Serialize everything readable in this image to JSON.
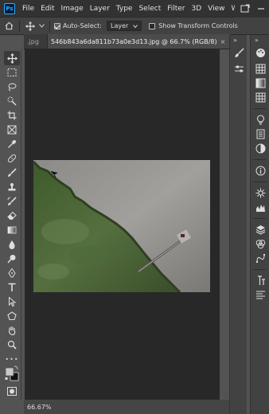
{
  "app": {
    "logo_text": "Ps"
  },
  "menu": {
    "items": [
      "File",
      "Edit",
      "Image",
      "Layer",
      "Type",
      "Select",
      "Filter",
      "3D",
      "View",
      "Windo"
    ]
  },
  "options": {
    "auto_select_label": "Auto-Select:",
    "auto_select_checked": true,
    "target_value": "Layer",
    "show_transform_label": "Show Transform Controls",
    "show_transform_checked": false
  },
  "tabs": [
    {
      "label": ".jpg",
      "active": false
    },
    {
      "label": "546b843a6da811b73a0e3d13.jpg @ 66.7% (RGB/8)",
      "active": true,
      "close": "×"
    }
  ],
  "tabs_overflow": "»",
  "status": {
    "zoom": "66.67%"
  },
  "icons": {
    "toolbar": [
      "move-tool-icon",
      "marquee-tool-icon",
      "lasso-tool-icon",
      "quick-select-tool-icon",
      "crop-tool-icon",
      "frame-tool-icon",
      "eyedropper-tool-icon",
      "healing-brush-icon",
      "brush-tool-icon",
      "clone-stamp-icon",
      "history-brush-icon",
      "eraser-tool-icon",
      "gradient-tool-icon",
      "blur-tool-icon",
      "dodge-tool-icon",
      "pen-tool-icon",
      "type-tool-icon",
      "path-select-icon",
      "shape-tool-icon",
      "hand-tool-icon",
      "zoom-tool-icon",
      "more-tools-icon",
      "color-swatches-icon",
      "quick-mask-icon",
      "screen-mode-icon"
    ]
  },
  "colors": {
    "foreground": "#c8c8c8",
    "background": "#111111",
    "accent": "#31a8ff"
  }
}
